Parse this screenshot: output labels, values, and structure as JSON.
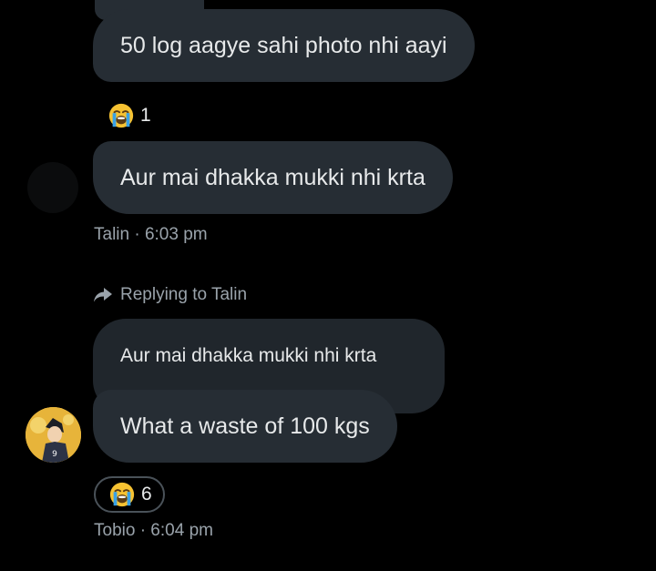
{
  "colors": {
    "background": "#000000",
    "bubble": "#262d34",
    "quoted_bubble": "#20262c",
    "text": "#e7e9ea",
    "meta_text": "#9aa3ab"
  },
  "messages": [
    {
      "text": "50 log aagye sahi photo nhi aayi",
      "reaction": {
        "icon": "loudly-crying-face-emoji",
        "count": "1"
      }
    },
    {
      "text": "Aur mai dhakka mukki nhi krta",
      "meta": "Talin · 6:03 pm"
    }
  ],
  "reply": {
    "replying_label": "Replying to Talin",
    "quoted_text": "Aur mai dhakka mukki nhi krta",
    "text": "What a waste of 100 kgs",
    "reaction": {
      "icon": "loudly-crying-face-emoji",
      "count": "6"
    },
    "meta": "Tobio · 6:04 pm"
  }
}
